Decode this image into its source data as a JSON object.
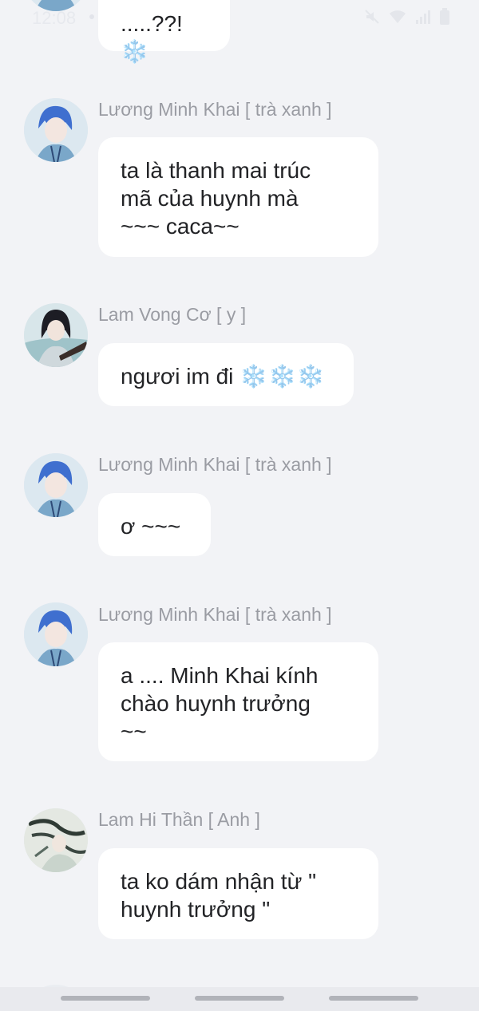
{
  "status_bar": {
    "time": "12:08",
    "icons": [
      "mute-icon",
      "wifi-icon",
      "signal-icon",
      "battery-icon"
    ]
  },
  "colors": {
    "background": "#f2f3f6",
    "bubble": "#ffffff",
    "sender_name": "#9a9ca3",
    "message_text": "#222326",
    "nav_pill": "#b1b3b9"
  },
  "messages": [
    {
      "sender": "",
      "avatar": "avatar-blue-hair",
      "text": ".....??!",
      "snowflakes": 1
    },
    {
      "sender": "Lương Minh Khai [ trà xanh ]",
      "avatar": "avatar-blue-hair",
      "lines": [
        "ta là thanh mai trúc",
        "mã của huynh mà",
        "~~~ caca~~"
      ]
    },
    {
      "sender": "Lam Vong Cơ [ y ]",
      "avatar": "avatar-black-hair",
      "text": "ngươi im đi ",
      "snowflakes": 3
    },
    {
      "sender": "Lương Minh Khai [ trà xanh ]",
      "avatar": "avatar-blue-hair",
      "text": "ơ ~~~"
    },
    {
      "sender": "Lương Minh Khai [ trà xanh ]",
      "avatar": "avatar-blue-hair",
      "lines": [
        "a .... Minh Khai kính",
        "chào huynh trưởng",
        "~~"
      ]
    },
    {
      "sender": "Lam Hi Thần [ Anh ]",
      "avatar": "avatar-sketch-hair",
      "lines": [
        "ta ko dám nhận từ \"",
        "huynh trưởng \""
      ]
    }
  ],
  "snowflake_glyph": "❄️"
}
